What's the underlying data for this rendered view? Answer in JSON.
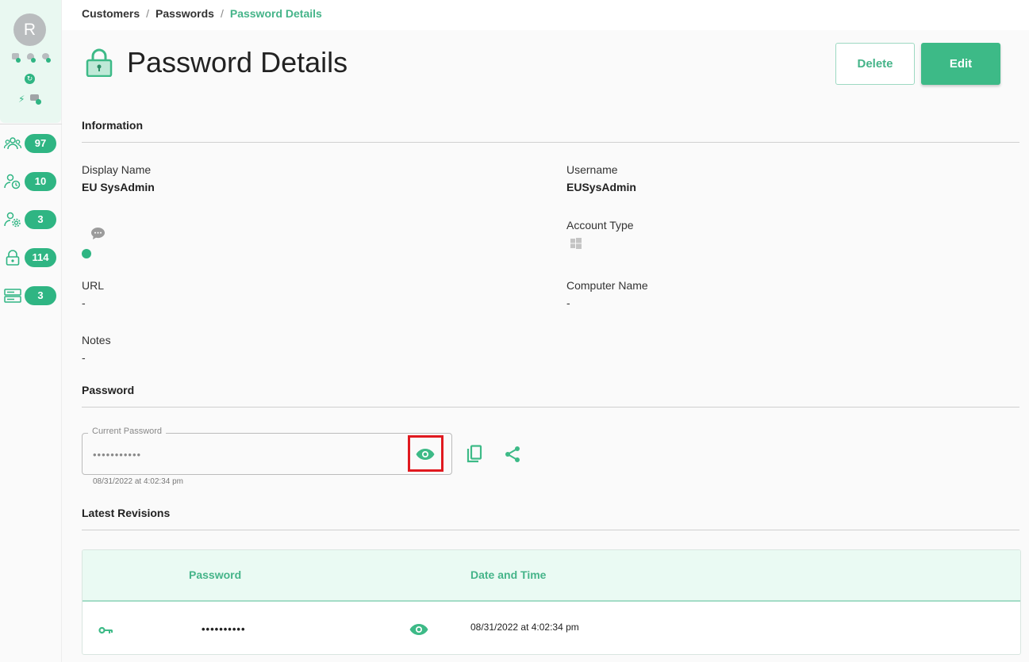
{
  "sidebar": {
    "avatar_letter": "R",
    "nav": [
      {
        "icon": "users-group-icon",
        "count": "97"
      },
      {
        "icon": "user-clock-icon",
        "count": "10"
      },
      {
        "icon": "user-gear-icon",
        "count": "3"
      },
      {
        "icon": "lock-icon",
        "count": "114"
      },
      {
        "icon": "server-icon",
        "count": "3"
      }
    ]
  },
  "breadcrumb": {
    "items": [
      "Customers",
      "Passwords"
    ],
    "current": "Password Details"
  },
  "header": {
    "title": "Password Details",
    "delete_label": "Delete",
    "edit_label": "Edit"
  },
  "information": {
    "section_title": "Information",
    "display_name_label": "Display Name",
    "display_name": "EU SysAdmin",
    "username_label": "Username",
    "username": "EUSysAdmin",
    "account_type_label": "Account Type",
    "account_type_icon": "windows-icon",
    "url_label": "URL",
    "url": "-",
    "computer_name_label": "Computer Name",
    "computer_name": "-",
    "notes_label": "Notes",
    "notes": "-"
  },
  "password": {
    "section_title": "Password",
    "field_label": "Current Password",
    "masked_value": "•••••••••••",
    "timestamp": "08/31/2022 at 4:02:34 pm"
  },
  "revisions": {
    "section_title": "Latest Revisions",
    "columns": [
      "Password",
      "Date and Time"
    ],
    "rows": [
      {
        "password": "••••••••••",
        "date": "08/31/2022 at 4:02:34 pm"
      }
    ]
  },
  "colors": {
    "accent": "#3dba87",
    "highlight": "#e0191f"
  }
}
